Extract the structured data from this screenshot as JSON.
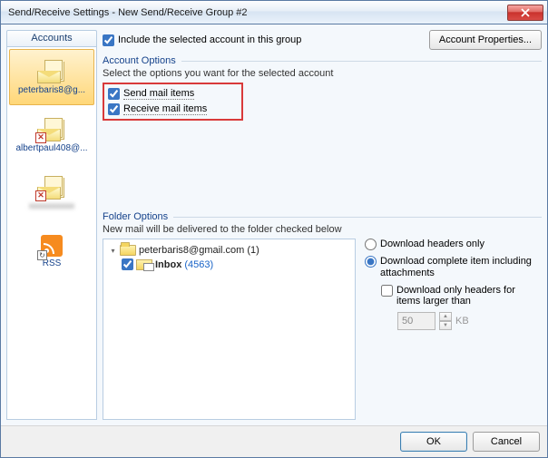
{
  "window_title": "Send/Receive Settings - New Send/Receive Group #2",
  "sidebar": {
    "header": "Accounts",
    "items": [
      {
        "label": "peterbaris8@g...",
        "selected": true,
        "error": false,
        "type": "mail"
      },
      {
        "label": "albertpaul408@...",
        "selected": false,
        "error": true,
        "type": "mail"
      },
      {
        "label": "",
        "selected": false,
        "error": true,
        "type": "mail",
        "blurred": true
      },
      {
        "label": "RSS",
        "selected": false,
        "error": false,
        "type": "rss"
      }
    ]
  },
  "include_checkbox": {
    "label": "Include the selected account in this group",
    "checked": true
  },
  "account_properties_btn": "Account Properties...",
  "account_options": {
    "legend": "Account Options",
    "desc": "Select the options you want for the selected account",
    "send": {
      "label": "Send mail items",
      "checked": true
    },
    "receive": {
      "label": "Receive mail items",
      "checked": true
    }
  },
  "folder_options": {
    "legend": "Folder Options",
    "desc": "New mail will be delivered to the folder checked below",
    "tree": {
      "root": {
        "label": "peterbaris8@gmail.com",
        "count": "(1)"
      },
      "child": {
        "label": "Inbox",
        "count": "(4563)",
        "checked": true
      }
    },
    "download": {
      "headers_only": {
        "label": "Download headers only",
        "selected": false
      },
      "complete": {
        "label": "Download complete item including attachments",
        "selected": true
      },
      "only_headers_larger": {
        "label": "Download only headers for items larger than",
        "checked": false
      },
      "size_value": "50",
      "size_unit": "KB"
    }
  },
  "buttons": {
    "ok": "OK",
    "cancel": "Cancel"
  }
}
